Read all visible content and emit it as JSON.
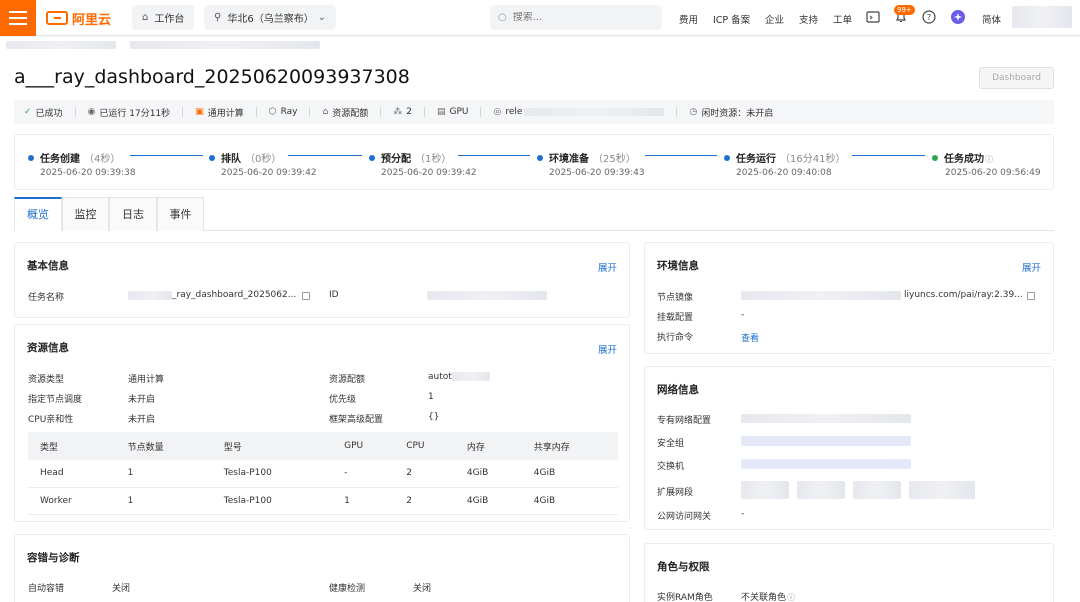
{
  "topbar": {
    "logo_text": "阿里云",
    "workbench": "工作台",
    "region": "华北6（乌兰察布）",
    "search_placeholder": "搜索...",
    "nav": [
      "费用",
      "ICP 备案",
      "企业",
      "支持",
      "工单"
    ],
    "notif_badge": "99+",
    "lang": "简体"
  },
  "job": {
    "title_visible": "a___ray_dashboard_20250620093937308",
    "dashboard_button": "Dashboard"
  },
  "status_bar": {
    "success": "已成功",
    "runtime": "已运行 17分11秒",
    "compute": "通用计算",
    "framework": "Ray",
    "resource_quota": "资源配额",
    "node_count": "2",
    "gpu": "GPU",
    "owner": "rele",
    "idle_resource": "闲时资源：未开启"
  },
  "steps": [
    {
      "name": "任务创建",
      "duration": "（4秒）",
      "time": "2025-06-20 09:39:38"
    },
    {
      "name": "排队",
      "duration": "（0秒）",
      "time": "2025-06-20 09:39:42"
    },
    {
      "name": "预分配",
      "duration": "（1秒）",
      "time": "2025-06-20 09:39:42"
    },
    {
      "name": "环境准备",
      "duration": "（25秒）",
      "time": "2025-06-20 09:39:43"
    },
    {
      "name": "任务运行",
      "duration": "（16分41秒）",
      "time": "2025-06-20 09:40:08"
    },
    {
      "name": "任务成功",
      "duration": "",
      "time": "2025-06-20 09:56:49"
    }
  ],
  "tabs": [
    "概览",
    "监控",
    "日志",
    "事件"
  ],
  "basic_info": {
    "title": "基本信息",
    "expand": "展开",
    "task_name_label": "任务名称",
    "task_name_value": "_ray_dashboard_2025062...",
    "id_label": "ID"
  },
  "resource_info": {
    "title": "资源信息",
    "expand": "展开",
    "rows": [
      {
        "l1": "资源类型",
        "v1": "通用计算",
        "l2": "资源配额",
        "v2": "autot"
      },
      {
        "l1": "指定节点调度",
        "v1": "未开启",
        "l2": "优先级",
        "v2": "1"
      },
      {
        "l1": "CPU亲和性",
        "v1": "未开启",
        "l2": "框架高级配置",
        "v2": "{}"
      }
    ],
    "table_headers": [
      "类型",
      "节点数量",
      "型号",
      "GPU",
      "CPU",
      "内存",
      "共享内存"
    ],
    "table_rows": [
      [
        "Head",
        "1",
        "Tesla-P100",
        "-",
        "2",
        "4GiB",
        "4GiB"
      ],
      [
        "Worker",
        "1",
        "Tesla-P100",
        "1",
        "2",
        "4GiB",
        "4GiB"
      ]
    ]
  },
  "fault": {
    "title": "容错与诊断",
    "auto_label": "自动容错",
    "auto_value": "关闭",
    "health_label": "健康检测",
    "health_value": "关闭"
  },
  "env_info": {
    "title": "环境信息",
    "expand": "展开",
    "image_label": "节点镜像",
    "image_value": "liyuncs.com/pai/ray:2.39...",
    "mount_label": "挂载配置",
    "mount_value": "-",
    "cmd_label": "执行命令",
    "cmd_value": "查看"
  },
  "network": {
    "title": "网络信息",
    "vpc_label": "专有网络配置",
    "sg_label": "安全组",
    "switch_label": "交换机",
    "ext_label": "扩展网段",
    "nat_label": "公网访问网关",
    "nat_value": "-"
  },
  "roles": {
    "title": "角色与权限",
    "ram_label": "实例RAM角色",
    "ram_value": "不关联角色"
  },
  "colors": {
    "brand": "#ff6a00",
    "primary": "#1f6fd1",
    "success": "#2da44e"
  }
}
